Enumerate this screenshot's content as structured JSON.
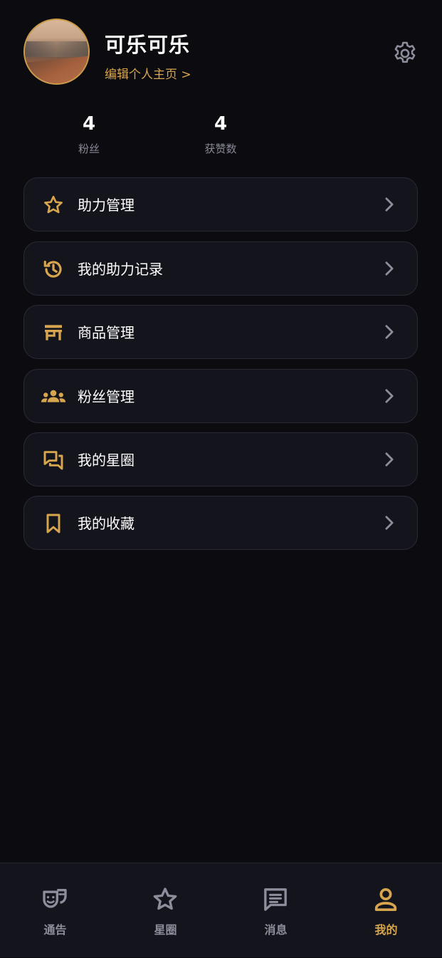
{
  "profile": {
    "username": "可乐可乐",
    "edit_link": "编辑个人主页 >"
  },
  "stats": [
    {
      "value": "4",
      "label": "粉丝"
    },
    {
      "value": "4",
      "label": "获赞数"
    }
  ],
  "menu": [
    {
      "label": "助力管理",
      "icon": "star-icon"
    },
    {
      "label": "我的助力记录",
      "icon": "history-icon"
    },
    {
      "label": "商品管理",
      "icon": "store-icon"
    },
    {
      "label": "粉丝管理",
      "icon": "group-icon"
    },
    {
      "label": "我的星圈",
      "icon": "chat-bubbles-icon"
    },
    {
      "label": "我的收藏",
      "icon": "bookmark-icon"
    }
  ],
  "tabs": [
    {
      "label": "通告",
      "icon": "theater-masks-icon",
      "active": false
    },
    {
      "label": "星圈",
      "icon": "star-outline-icon",
      "active": false
    },
    {
      "label": "消息",
      "icon": "message-icon",
      "active": false
    },
    {
      "label": "我的",
      "icon": "person-icon",
      "active": true
    }
  ],
  "colors": {
    "background": "#0b0b10",
    "card": "#14141d",
    "accent": "#d8a54f",
    "muted": "#8d8d9b"
  }
}
